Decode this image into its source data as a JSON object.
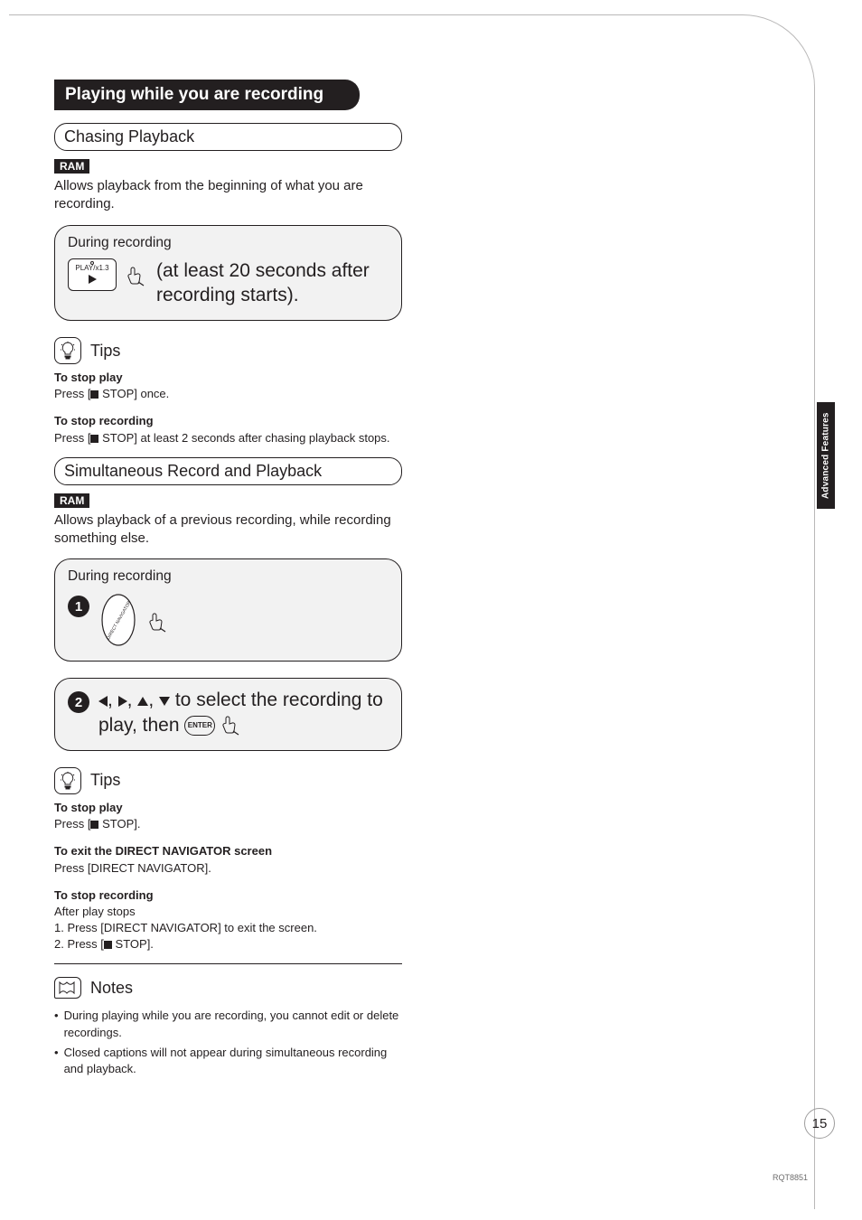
{
  "section_title": "Playing while you are recording",
  "subsection_a": {
    "pill": "Chasing Playback",
    "badge": "RAM",
    "desc": "Allows playback from the beginning of what you are recording.",
    "inst": {
      "label": "During recording",
      "play_btn_text": "PLAY/x1.3",
      "main": "(at least 20 seconds after recording starts)."
    },
    "tips_title": "Tips",
    "tips": [
      {
        "bold": "To stop play",
        "line": "Press [■ STOP] once."
      },
      {
        "bold": "To stop recording",
        "line": "Press [■ STOP] at least 2 seconds after chasing playback stops."
      }
    ]
  },
  "subsection_b": {
    "pill": "Simultaneous Record and Playback",
    "badge": "RAM",
    "desc": "Allows playback of a previous recording, while recording something else.",
    "inst1": {
      "label": "During recording",
      "num": "1",
      "dn_text": "DIRECT NAVIGATOR"
    },
    "inst2": {
      "num": "2",
      "pre": "",
      "main_a": " to select the recording to play, then ",
      "enter": "ENTER"
    },
    "tips_title": "Tips",
    "tips": [
      {
        "bold": "To stop play",
        "lines": [
          "Press [■ STOP]."
        ]
      },
      {
        "bold": "To exit the DIRECT NAVIGATOR screen",
        "lines": [
          "Press [DIRECT NAVIGATOR]."
        ]
      },
      {
        "bold": "To stop recording",
        "lines": [
          "After play stops",
          "1. Press [DIRECT NAVIGATOR] to exit the screen.",
          "2. Press [■ STOP]."
        ]
      }
    ]
  },
  "notes": {
    "title": "Notes",
    "items": [
      "During playing while you are recording, you cannot edit or delete recordings.",
      "Closed captions will not appear during simultaneous recording and playback."
    ]
  },
  "side_tab": "Advanced Features",
  "page_number": "15",
  "doc_id": "RQT8851"
}
